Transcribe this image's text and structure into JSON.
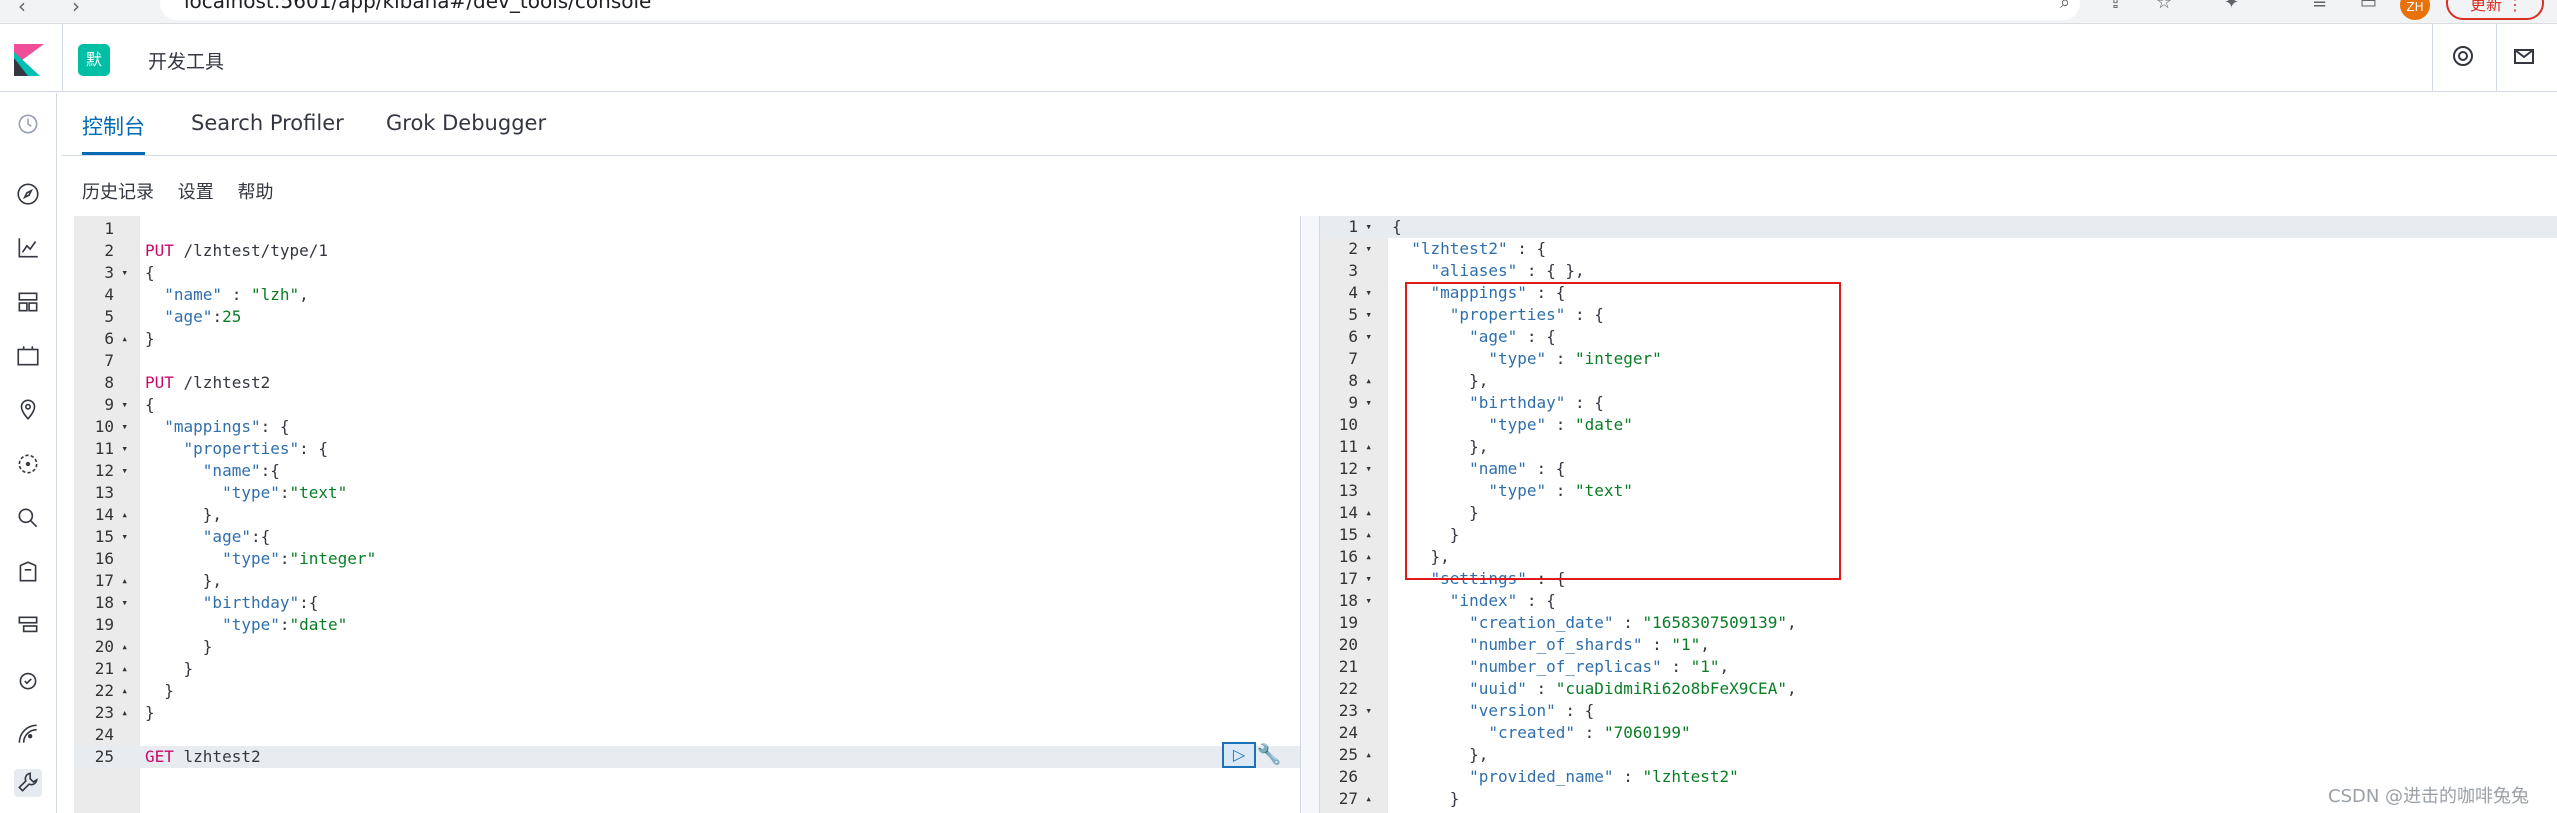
{
  "browser": {
    "url": "localhost:5601/app/kibana#/dev_tools/console",
    "profile_initial": "ZH",
    "update_label": "更新 ⋮"
  },
  "header": {
    "space_initial": "默",
    "breadcrumb": "开发工具"
  },
  "tabs": [
    {
      "label": "控制台",
      "selected": true
    },
    {
      "label": "Search Profiler",
      "selected": false
    },
    {
      "label": "Grok Debugger",
      "selected": false
    }
  ],
  "toolbar": {
    "history": "历史记录",
    "settings": "设置",
    "help": "帮助"
  },
  "request": {
    "lines": [
      {
        "n": "1",
        "fold": "",
        "text": ""
      },
      {
        "n": "2",
        "fold": "",
        "text": "PUT /lzhtest/type/1"
      },
      {
        "n": "3",
        "fold": "▾",
        "text": "{"
      },
      {
        "n": "4",
        "fold": "",
        "text": "  \"name\" : \"lzh\","
      },
      {
        "n": "5",
        "fold": "",
        "text": "  \"age\":25"
      },
      {
        "n": "6",
        "fold": "▴",
        "text": "}"
      },
      {
        "n": "7",
        "fold": "",
        "text": ""
      },
      {
        "n": "8",
        "fold": "",
        "text": "PUT /lzhtest2"
      },
      {
        "n": "9",
        "fold": "▾",
        "text": "{"
      },
      {
        "n": "10",
        "fold": "▾",
        "text": "  \"mappings\": {"
      },
      {
        "n": "11",
        "fold": "▾",
        "text": "    \"properties\": {"
      },
      {
        "n": "12",
        "fold": "▾",
        "text": "      \"name\":{"
      },
      {
        "n": "13",
        "fold": "",
        "text": "        \"type\":\"text\""
      },
      {
        "n": "14",
        "fold": "▴",
        "text": "      },"
      },
      {
        "n": "15",
        "fold": "▾",
        "text": "      \"age\":{"
      },
      {
        "n": "16",
        "fold": "",
        "text": "        \"type\":\"integer\""
      },
      {
        "n": "17",
        "fold": "▴",
        "text": "      },"
      },
      {
        "n": "18",
        "fold": "▾",
        "text": "      \"birthday\":{"
      },
      {
        "n": "19",
        "fold": "",
        "text": "        \"type\":\"date\""
      },
      {
        "n": "20",
        "fold": "▴",
        "text": "      }"
      },
      {
        "n": "21",
        "fold": "▴",
        "text": "    }"
      },
      {
        "n": "22",
        "fold": "▴",
        "text": "  }"
      },
      {
        "n": "23",
        "fold": "▴",
        "text": "}"
      },
      {
        "n": "24",
        "fold": "",
        "text": ""
      },
      {
        "n": "25",
        "fold": "",
        "text": "GET lzhtest2"
      }
    ]
  },
  "response": {
    "lines": [
      {
        "n": "1",
        "fold": "▾",
        "text": "{"
      },
      {
        "n": "2",
        "fold": "▾",
        "text": "  \"lzhtest2\" : {"
      },
      {
        "n": "3",
        "fold": "",
        "text": "    \"aliases\" : { },"
      },
      {
        "n": "4",
        "fold": "▾",
        "text": "    \"mappings\" : {"
      },
      {
        "n": "5",
        "fold": "▾",
        "text": "      \"properties\" : {"
      },
      {
        "n": "6",
        "fold": "▾",
        "text": "        \"age\" : {"
      },
      {
        "n": "7",
        "fold": "",
        "text": "          \"type\" : \"integer\""
      },
      {
        "n": "8",
        "fold": "▴",
        "text": "        },"
      },
      {
        "n": "9",
        "fold": "▾",
        "text": "        \"birthday\" : {"
      },
      {
        "n": "10",
        "fold": "",
        "text": "          \"type\" : \"date\""
      },
      {
        "n": "11",
        "fold": "▴",
        "text": "        },"
      },
      {
        "n": "12",
        "fold": "▾",
        "text": "        \"name\" : {"
      },
      {
        "n": "13",
        "fold": "",
        "text": "          \"type\" : \"text\""
      },
      {
        "n": "14",
        "fold": "▴",
        "text": "        }"
      },
      {
        "n": "15",
        "fold": "▴",
        "text": "      }"
      },
      {
        "n": "16",
        "fold": "▴",
        "text": "    },"
      },
      {
        "n": "17",
        "fold": "▾",
        "text": "    \"settings\" : {"
      },
      {
        "n": "18",
        "fold": "▾",
        "text": "      \"index\" : {"
      },
      {
        "n": "19",
        "fold": "",
        "text": "        \"creation_date\" : \"1658307509139\","
      },
      {
        "n": "20",
        "fold": "",
        "text": "        \"number_of_shards\" : \"1\","
      },
      {
        "n": "21",
        "fold": "",
        "text": "        \"number_of_replicas\" : \"1\","
      },
      {
        "n": "22",
        "fold": "",
        "text": "        \"uuid\" : \"cuaDidmiRi62o8bFeX9CEA\","
      },
      {
        "n": "23",
        "fold": "▾",
        "text": "        \"version\" : {"
      },
      {
        "n": "24",
        "fold": "",
        "text": "          \"created\" : \"7060199\""
      },
      {
        "n": "25",
        "fold": "▴",
        "text": "        },"
      },
      {
        "n": "26",
        "fold": "",
        "text": "        \"provided_name\" : \"lzhtest2\""
      },
      {
        "n": "27",
        "fold": "▴",
        "text": "      }"
      }
    ]
  },
  "watermark": "CSDN @进击的咖啡兔兔",
  "colors": {
    "accent": "#006bb4",
    "highlight_box": "#e0191d",
    "method": "#c80a68",
    "string": "#0a7d26",
    "key": "#2f6fab"
  }
}
